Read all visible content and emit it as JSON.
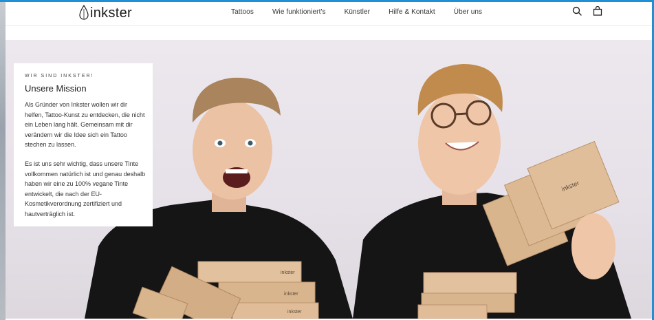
{
  "header": {
    "logo_text": "inkster",
    "nav": [
      {
        "label": "Tattoos"
      },
      {
        "label": "Wie funktioniert's"
      },
      {
        "label": "Künstler"
      },
      {
        "label": "Hilfe & Kontakt"
      },
      {
        "label": "Über uns"
      }
    ],
    "icons": [
      "search-icon",
      "cart-icon"
    ]
  },
  "hero": {
    "eyebrow": "WIR SIND INKSTER!",
    "title": "Unsere Mission",
    "paragraphs": [
      "Als Gründer von Inkster wollen wir dir helfen, Tattoo-Kunst zu entdecken, die nicht ein Leben lang hält. Gemeinsam mit dir verändern wir die Idee sich ein Tattoo stechen zu lassen.",
      "Es ist uns sehr wichtig, dass unsere Tinte vollkommen natürlich ist und genau deshalb haben wir eine zu 100% vegane Tinte entwickelt, die nach der EU-Kosmetikverordnung zertifiziert und hautverträglich ist."
    ],
    "box_label": "inkster"
  },
  "colors": {
    "accent": "#1f8fd6",
    "hero_bg": "#e9e4eb",
    "shirt": "#151515",
    "box": "#d9b58e"
  }
}
